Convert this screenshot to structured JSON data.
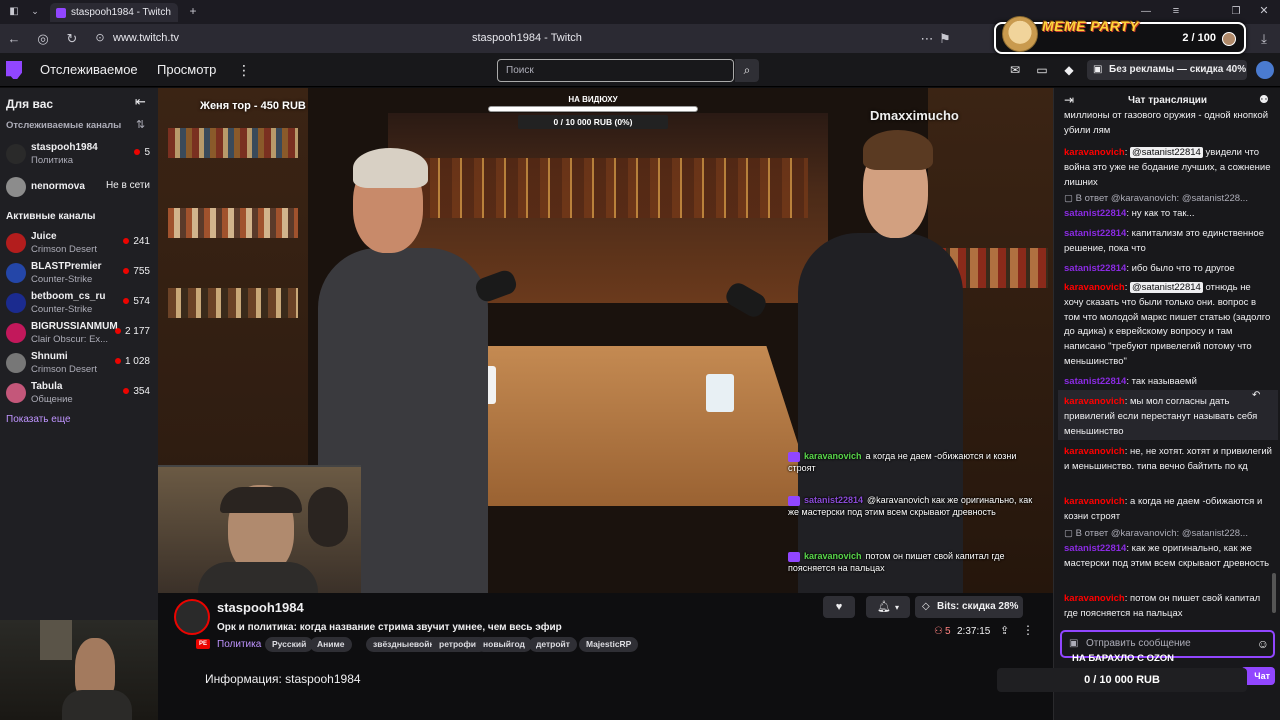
{
  "browser": {
    "tab_title": "staspooh1984 - Twitch",
    "url": "www.twitch.tv",
    "page_title": "staspooh1984 - Twitch"
  },
  "meme_overlay": {
    "title": "MEME PARTY",
    "count": "2 / 100"
  },
  "nav": {
    "following": "Отслеживаемое",
    "browse": "Просмотр",
    "search_placeholder": "Поиск",
    "ad_free": "Без рекламы — скидка 40%"
  },
  "sidebar": {
    "for_you": "Для вас",
    "followed_heading": "Отслеживаемые каналы",
    "followed": [
      {
        "name": "staspooh1984",
        "game": "Политика",
        "viewers": "5",
        "live": true,
        "color": "#2a2a2a"
      },
      {
        "name": "nenormova",
        "game": "",
        "viewers": "Не в сети",
        "live": false,
        "color": "#8c8c8c"
      }
    ],
    "active_heading": "Активные каналы",
    "active": [
      {
        "name": "Juice",
        "game": "Crimson Desert",
        "viewers": "241",
        "color": "#b31d1d"
      },
      {
        "name": "BLASTPremier",
        "game": "Counter-Strike",
        "viewers": "755",
        "color": "#2446a8"
      },
      {
        "name": "betboom_cs_ru",
        "game": "Counter-Strike",
        "viewers": "574",
        "color": "#1b2b8f"
      },
      {
        "name": "BIGRUSSIANMUM",
        "game": "Clair Obscur: Ex...",
        "viewers": "2 177",
        "color": "#c2185b"
      },
      {
        "name": "Shnumi",
        "game": "Crimson Desert",
        "viewers": "1 028",
        "color": "#777777"
      },
      {
        "name": "Tabula",
        "game": "Общение",
        "viewers": "354",
        "color": "#c4577a"
      }
    ],
    "show_more": "Показать еще"
  },
  "video": {
    "donor_text": "Женя тор - 450 RUB",
    "goal_title": "НА ВИДЮХУ",
    "goal_value": "0 / 10 000 RUB (0%)",
    "goal_progress_fraction": 0,
    "watermark": "Dmaxximucho",
    "overlay_chat": [
      {
        "user": "karavanovich",
        "text": "а когда не даем -обижаются и козни строят",
        "purple": false
      },
      {
        "user": "satanist22814",
        "text": "@karavanovich как же оригинально, как же мастерски под этим всем скрывают древность",
        "purple": true
      },
      {
        "user": "karavanovich",
        "text": "потом он пишет свой капитал где поясняется на пальцах",
        "purple": false
      }
    ]
  },
  "stream": {
    "channel": "staspooh1984",
    "title": "Орк и политика: когда название стрима звучит умнее, чем весь эфир",
    "category": "Политика",
    "tags": [
      "Русский",
      "Аниме",
      "звёздныевойны",
      "ретрофит",
      "новыйгод",
      "детройт",
      "MajesticRP"
    ],
    "bits": "Bits: скидка 28%",
    "viewers": "5",
    "uptime": "2:37:15",
    "about": "Информация: staspooh1984"
  },
  "chat": {
    "header": "Чат трансляции",
    "input_placeholder": "Отправить сообщение",
    "send_label": "Чат",
    "bottom_banner": "НА БАРАХЛО С OZON",
    "bottom_goal": "0 / 10 000 RUB",
    "messages": [
      {
        "kind": "text",
        "text": "миллионы от газового оружия - одной кнопкой убили лям"
      },
      {
        "kind": "msg",
        "user": "karavanovich",
        "mention": "@satanist22814",
        "text": " увидели что война это уже не бодание лучших, а сожнение лишних"
      },
      {
        "kind": "reply",
        "text": "В ответ @karavanovich: @satanist228..."
      },
      {
        "kind": "msg",
        "user": "satanist22814",
        "text": "ну как то так..."
      },
      {
        "kind": "msg",
        "user": "satanist22814",
        "text": "капитализм это единственное решение, пока что"
      },
      {
        "kind": "msg",
        "user": "satanist22814",
        "text": "ибо было что то другое"
      },
      {
        "kind": "msg",
        "user": "karavanovich",
        "mention": "@satanist22814",
        "text": " отнюдь не хочу сказать что были только они. вопрос в том что молодой маркс пишет статью (задолго до адика) к еврейскому вопросу и там написано \"требуют привелегий потому что меньшинство\""
      },
      {
        "kind": "msg",
        "user": "satanist22814",
        "text": "так называемй"
      },
      {
        "kind": "msg",
        "user": "karavanovich",
        "text": "мы мол согласны дать привилегий если перестанут называть себя меньшинство"
      },
      {
        "kind": "msg",
        "user": "karavanovich",
        "text": "не, не хотят. хотят и привилегий и меньшинство. типа вечно байтить по кд"
      },
      {
        "kind": "msg",
        "user": "karavanovich",
        "text": "а когда не даем -обижаются и козни строят"
      },
      {
        "kind": "reply",
        "text": "В ответ @karavanovich: @satanist228..."
      },
      {
        "kind": "msg",
        "user": "satanist22814",
        "text": "как же оригинально, как же мастерски под этим всем скрывают древность"
      },
      {
        "kind": "msg",
        "user": "karavanovich",
        "text": "потом он пишет свой капитал где поясняется на пальцах"
      }
    ]
  }
}
